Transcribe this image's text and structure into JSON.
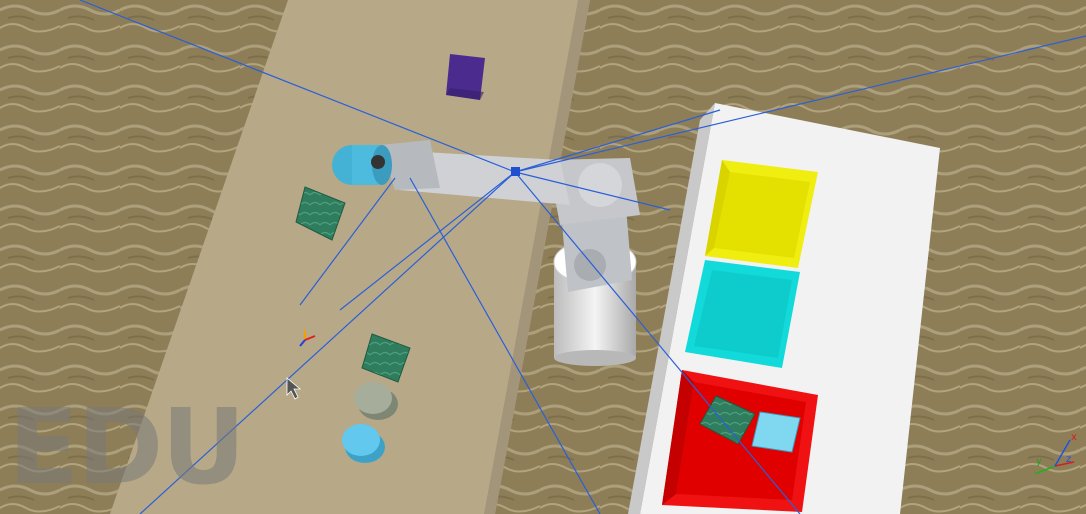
{
  "watermark": "EDU",
  "axis_gizmo": {
    "x": "x",
    "y": "y",
    "z": "z"
  },
  "colors": {
    "floor": "#8d7d58",
    "conveyor": "#b9aa8c",
    "table": "#f3f3f3",
    "bin_yellow": "#f2f20a",
    "bin_cyan": "#12d6d6",
    "bin_red": "#ee1010",
    "robot": "#c4c6cb",
    "gripper_tool": "#45b6d6",
    "cube_purple": "#4a2a8a",
    "cube_green": "#2e7a5c",
    "sensor_lines": "#2a5fd8"
  }
}
